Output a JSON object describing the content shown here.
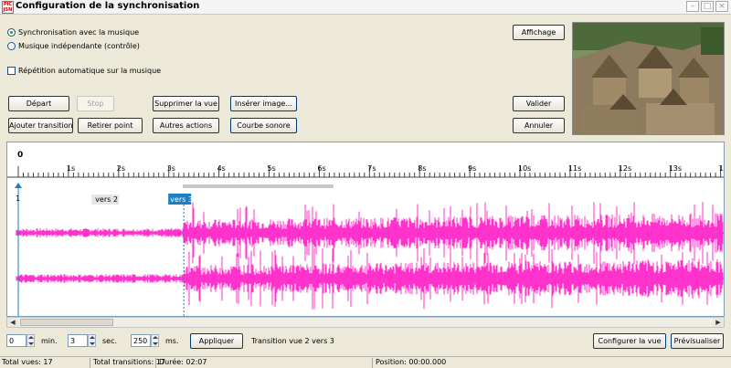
{
  "window": {
    "title": "Configuration de la synchronisation",
    "icon_text": "PIC JSN"
  },
  "options": {
    "sync_music": "Synchronisation avec la musique",
    "music_independent": "Musique indépendante (contrôle)",
    "auto_repeat": "Répétition automatique sur la musique",
    "selected": "sync_music",
    "auto_repeat_checked": false
  },
  "buttons": {
    "depart": "Départ",
    "stop": "Stop",
    "supprimer_vue": "Supprimer la vue",
    "inserer_image": "Insérer image...",
    "ajouter_transition": "Ajouter transition",
    "retirer_point": "Retirer point",
    "autres_actions": "Autres actions",
    "courbe_sonore": "Courbe sonore",
    "affichage": "Affichage",
    "valider": "Valider",
    "annuler": "Annuler",
    "appliquer": "Appliquer",
    "configurer_vue": "Configurer la vue",
    "previsualiser": "Prévisualiser"
  },
  "timeline": {
    "start_label": "0",
    "unit": "s",
    "tick_labels": [
      "1s",
      "2s",
      "3s",
      "4s",
      "5s",
      "6s",
      "7s",
      "8s",
      "9s",
      "10s",
      "11s",
      "12s",
      "13s",
      "14"
    ],
    "points": [
      {
        "label": "1",
        "time": 0
      },
      {
        "label": "vers 2",
        "time": 0.75
      },
      {
        "label": "vers 3",
        "time": 3.3
      }
    ],
    "waveform_color": "#ff33cc",
    "cursor_color": "#1a7fc4"
  },
  "controls": {
    "minutes": "0",
    "minutes_label": "min.",
    "seconds": "3",
    "seconds_label": "sec.",
    "ms": "250",
    "ms_label": "ms.",
    "transition_label": "Transition vue 2 vers 3"
  },
  "status": {
    "total_vues": "Total vues: 17",
    "total_transitions": "Total transitions: 17",
    "duree": "Durée: 02:07",
    "position": "Position: 00:00.000"
  }
}
